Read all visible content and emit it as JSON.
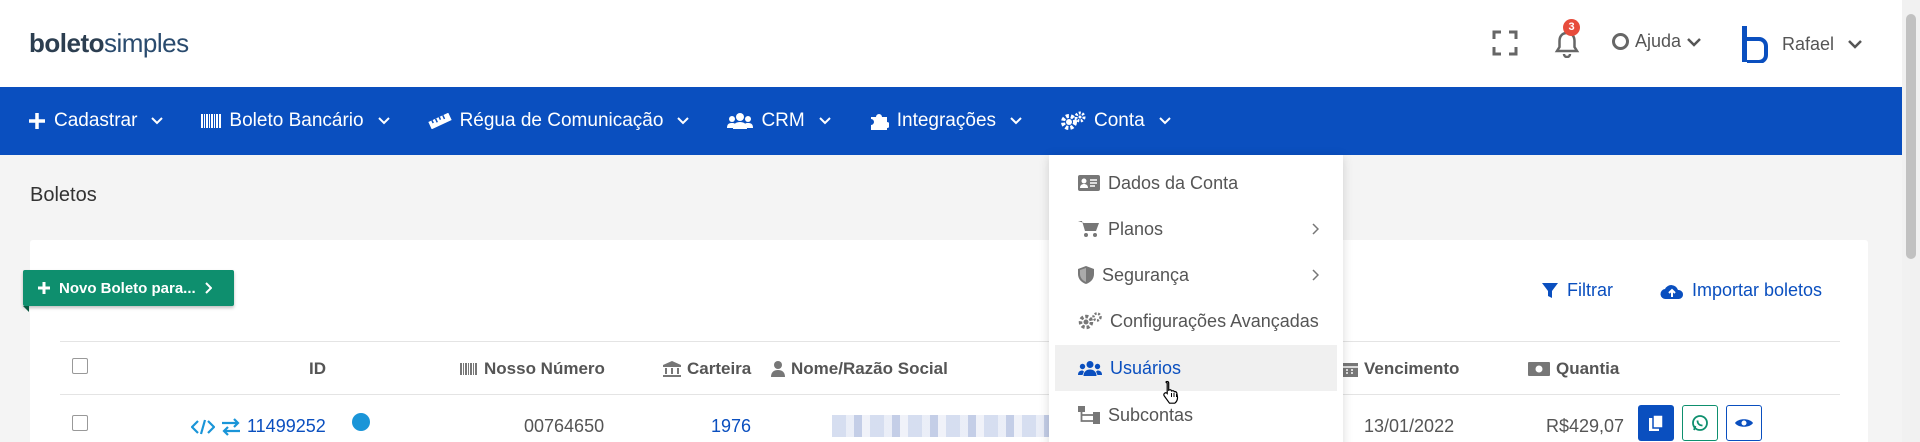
{
  "header": {
    "logo_bold": "boleto",
    "logo_light": "simples",
    "notification_count": "3",
    "help_label": "Ajuda",
    "user_name": "Rafael"
  },
  "nav": {
    "items": [
      {
        "label": "Cadastrar",
        "icon": "plus-icon"
      },
      {
        "label": "Boleto Bancário",
        "icon": "barcode-icon"
      },
      {
        "label": "Régua de Comunicação",
        "icon": "ruler-icon"
      },
      {
        "label": "CRM",
        "icon": "users-icon"
      },
      {
        "label": "Integrações",
        "icon": "puzzle-icon"
      },
      {
        "label": "Conta",
        "icon": "gears-icon"
      }
    ]
  },
  "page": {
    "title": "Boletos",
    "new_button": "Novo Boleto para...",
    "filter": "Filtrar",
    "import": "Importar boletos"
  },
  "table": {
    "headers": {
      "id": "ID",
      "nosso_numero": "Nosso Número",
      "carteira": "Carteira",
      "nome": "Nome/Razão Social",
      "vencimento": "Vencimento",
      "quantia": "Quantia"
    },
    "rows": [
      {
        "id": "11499252",
        "nosso_numero": "00764650",
        "carteira": "1976",
        "vencimento": "13/01/2022",
        "quantia": "R$429,07"
      }
    ]
  },
  "dropdown": {
    "items": [
      {
        "label": "Dados da Conta",
        "icon": "id-card-icon",
        "submenu": false
      },
      {
        "label": "Planos",
        "icon": "cart-icon",
        "submenu": true
      },
      {
        "label": "Segurança",
        "icon": "shield-icon",
        "submenu": true
      },
      {
        "label": "Configurações Avançadas",
        "icon": "gears-icon",
        "submenu": false
      },
      {
        "label": "Usuários",
        "icon": "users-icon",
        "submenu": false,
        "active": true
      },
      {
        "label": "Subcontas",
        "icon": "sitemap-icon",
        "submenu": false
      }
    ]
  },
  "colors": {
    "primary": "#0a4fbf",
    "success": "#0e8f6e",
    "badge": "#e74c3c",
    "status_dot": "#1a95d8"
  }
}
